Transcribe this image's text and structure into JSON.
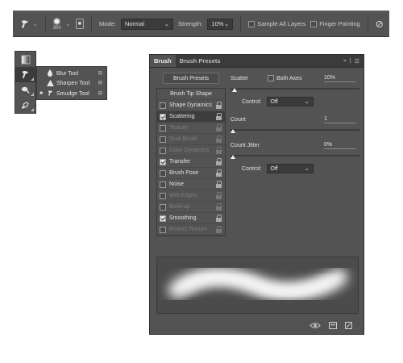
{
  "options_bar": {
    "brush_size": "300",
    "mode_label": "Mode:",
    "mode_value": "Normal",
    "strength_label": "Strength:",
    "strength_value": "10%",
    "sample_all_layers": "Sample All Layers",
    "finger_painting": "Finger Painting"
  },
  "tool_strip": {
    "tools": [
      {
        "icon": "gradient-icon"
      },
      {
        "icon": "smudge-icon"
      },
      {
        "icon": "dodge-icon"
      },
      {
        "icon": "pen-icon"
      }
    ]
  },
  "flyout": {
    "items": [
      {
        "label": "Blur Tool",
        "key": "R",
        "selected": false
      },
      {
        "label": "Sharpen Tool",
        "key": "R",
        "selected": false
      },
      {
        "label": "Smudge Tool",
        "key": "R",
        "selected": true
      }
    ]
  },
  "panel": {
    "tabs": [
      "Brush",
      "Brush Presets"
    ],
    "presets_button": "Brush Presets",
    "tip_shape": "Brush Tip Shape",
    "options": [
      {
        "label": "Shape Dynamics",
        "checked": false,
        "disabled": false,
        "selected": false
      },
      {
        "label": "Scattering",
        "checked": true,
        "disabled": false,
        "selected": true
      },
      {
        "label": "Texture",
        "checked": false,
        "disabled": true,
        "selected": false
      },
      {
        "label": "Dual Brush",
        "checked": false,
        "disabled": true,
        "selected": false
      },
      {
        "label": "Color Dynamics",
        "checked": false,
        "disabled": true,
        "selected": false
      },
      {
        "label": "Transfer",
        "checked": true,
        "disabled": false,
        "selected": false
      },
      {
        "label": "Brush Pose",
        "checked": false,
        "disabled": false,
        "selected": false
      },
      {
        "label": "Noise",
        "checked": false,
        "disabled": false,
        "selected": false
      },
      {
        "label": "Wet Edges",
        "checked": false,
        "disabled": true,
        "selected": false
      },
      {
        "label": "Build-up",
        "checked": false,
        "disabled": true,
        "selected": false
      },
      {
        "label": "Smoothing",
        "checked": true,
        "disabled": false,
        "selected": false
      },
      {
        "label": "Protect Texture",
        "checked": false,
        "disabled": true,
        "selected": false
      }
    ],
    "scatter": {
      "label": "Scatter",
      "both_axes": "Both Axes",
      "value": "10%",
      "level": 0.01
    },
    "scatter_control": {
      "label": "Control:",
      "value": "Off"
    },
    "count": {
      "label": "Count",
      "value": "1",
      "level": 0.0
    },
    "count_jitter": {
      "label": "Count Jitter",
      "value": "0%",
      "level": 0.0
    },
    "jitter_control": {
      "label": "Control:",
      "value": "Off"
    }
  }
}
